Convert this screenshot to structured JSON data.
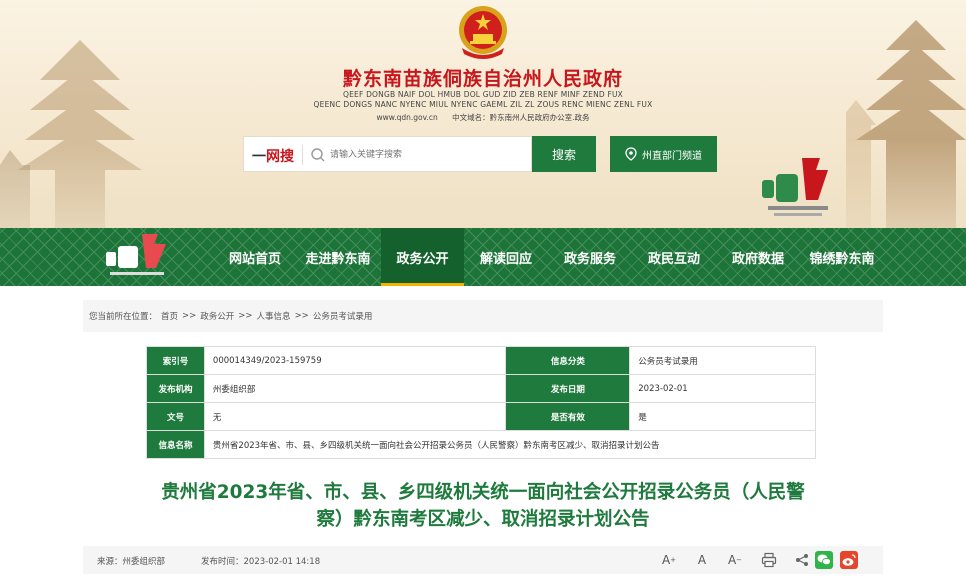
{
  "header": {
    "site_title": "黔东南苗族侗族自治州人民政府",
    "english_line1": "QEEF DONGB NAIF DOL HMUB DOL GUD ZID ZEB RENF MINF ZEND FUX",
    "english_line2": "QEENC DONGS NANC NYENC MIUL NYENC GAEML ZIL ZL ZOUS RENC MIENC ZENL FUX",
    "url": "www.qdn.gov.cn",
    "domain_label": "中文域名：黔东南州人民政府办公室.政务",
    "search_brand_dash": "一",
    "search_brand_text": "网搜",
    "search_placeholder": "请输入关键字搜索",
    "search_button": "搜索",
    "dept_button": "州直部门频道"
  },
  "nav": {
    "items": [
      {
        "label": "网站首页",
        "active": false
      },
      {
        "label": "走进黔东南",
        "active": false
      },
      {
        "label": "政务公开",
        "active": true
      },
      {
        "label": "解读回应",
        "active": false
      },
      {
        "label": "政务服务",
        "active": false
      },
      {
        "label": "政民互动",
        "active": false
      },
      {
        "label": "政府数据",
        "active": false
      },
      {
        "label": "锦绣黔东南",
        "active": false
      }
    ]
  },
  "breadcrumb": {
    "prefix": "您当前所在位置：",
    "items": [
      "首页",
      "政务公开",
      "人事信息",
      "公务员考试录用"
    ],
    "sep": ">>"
  },
  "info_table": {
    "rows": [
      {
        "k1": "索引号",
        "v1": "000014349/2023-159759",
        "k2": "信息分类",
        "v2": "公务员考试录用"
      },
      {
        "k1": "发布机构",
        "v1": "州委组织部",
        "k2": "发布日期",
        "v2": "2023-02-01"
      },
      {
        "k1": "文号",
        "v1": "无",
        "k2": "是否有效",
        "v2": "是"
      }
    ],
    "name_key": "信息名称",
    "name_value": "贵州省2023年省、市、县、乡四级机关统一面向社会公开招录公务员（人民警察）黔东南考区减少、取消招录计划公告"
  },
  "article": {
    "title_line1": "贵州省2023年省、市、县、乡四级机关统一面向社会公开招录公务员（人民警",
    "title_line2": "察）黔东南考区减少、取消招录计划公告",
    "source": "来源：州委组织部",
    "published": "发布时间：2023-02-01 14:18"
  },
  "colors": {
    "brand_green": "#1f7a3d",
    "brand_red": "#c8161d",
    "nav_active_underline": "#f0b400"
  }
}
